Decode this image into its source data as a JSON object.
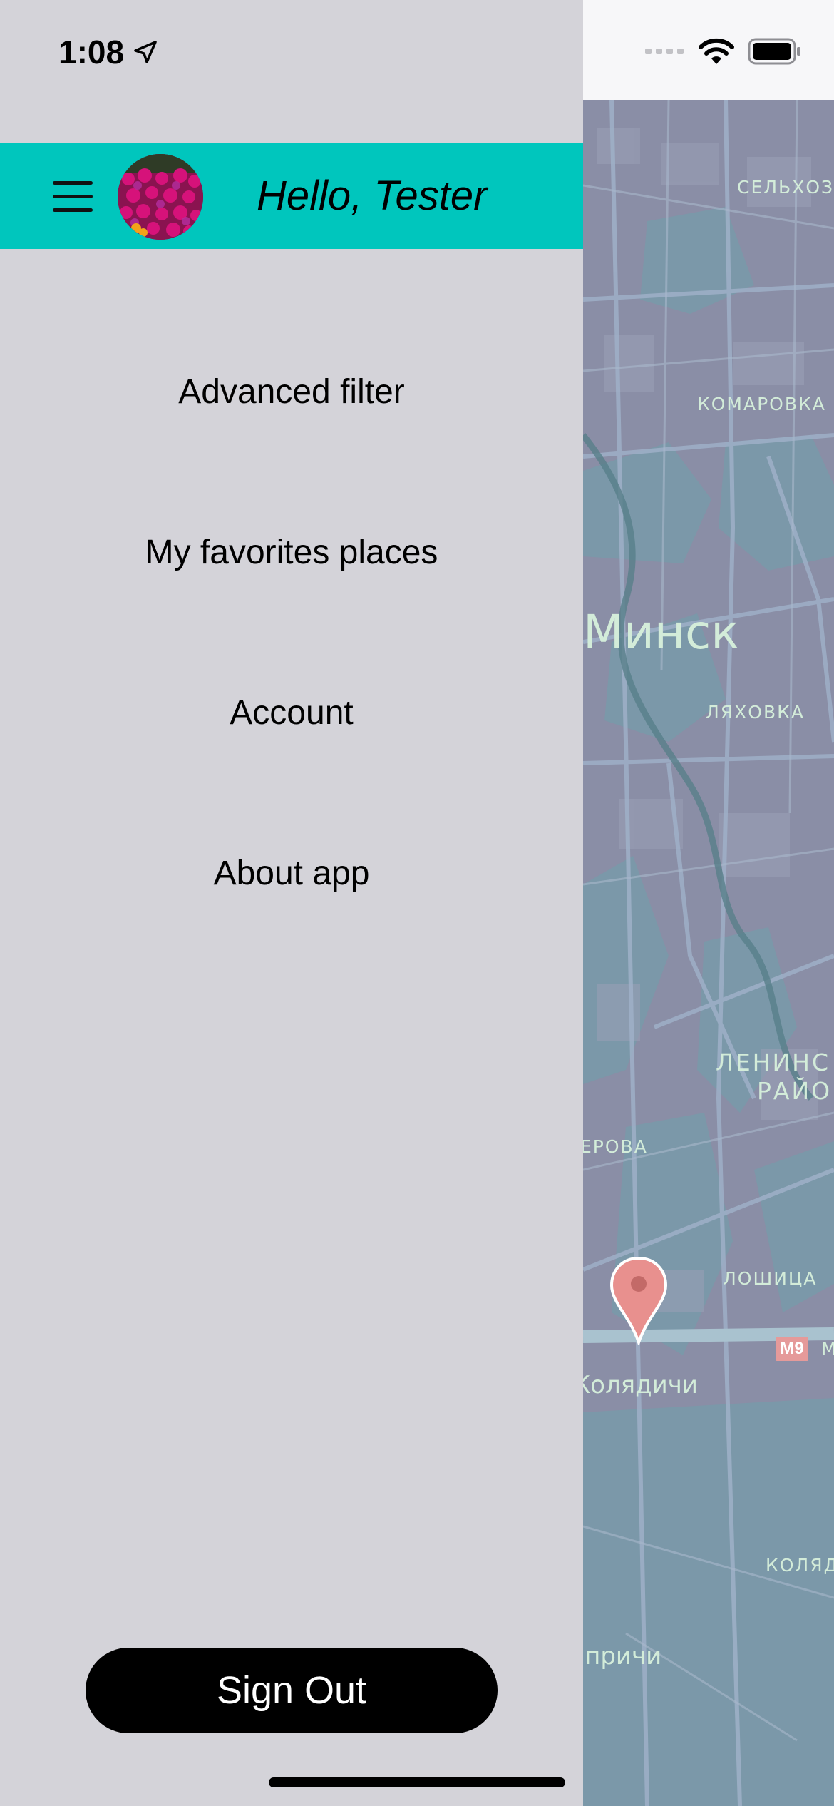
{
  "status_bar": {
    "time": "1:08"
  },
  "header": {
    "greeting": "Hello, Tester"
  },
  "menu": {
    "items": [
      {
        "label": "Advanced filter"
      },
      {
        "label": "My favorites places"
      },
      {
        "label": "Account"
      },
      {
        "label": "About app"
      }
    ]
  },
  "footer": {
    "sign_out_label": "Sign Out"
  },
  "map": {
    "labels": {
      "selkhoz": "СЕЛЬХОЗ",
      "komarovka": "КОМАРОВКА",
      "minsk": "Минск",
      "lyakhovka": "ЛЯХОВКА",
      "lenin_1": "ЛЕНИНС",
      "lenin_2": "РАЙО",
      "erova": "ЕРОВА",
      "loshitsa": "ЛОШИЦА",
      "kolyadichi": "Колядичи",
      "kolyad_small": "КОЛЯД",
      "richi": "ипричи",
      "road_m": "M"
    },
    "road_badge": "M9",
    "pin_color": "#e8908e"
  },
  "colors": {
    "accent": "#00c6bd",
    "drawer_bg": "#d4d3d9",
    "button_bg": "#000000"
  }
}
